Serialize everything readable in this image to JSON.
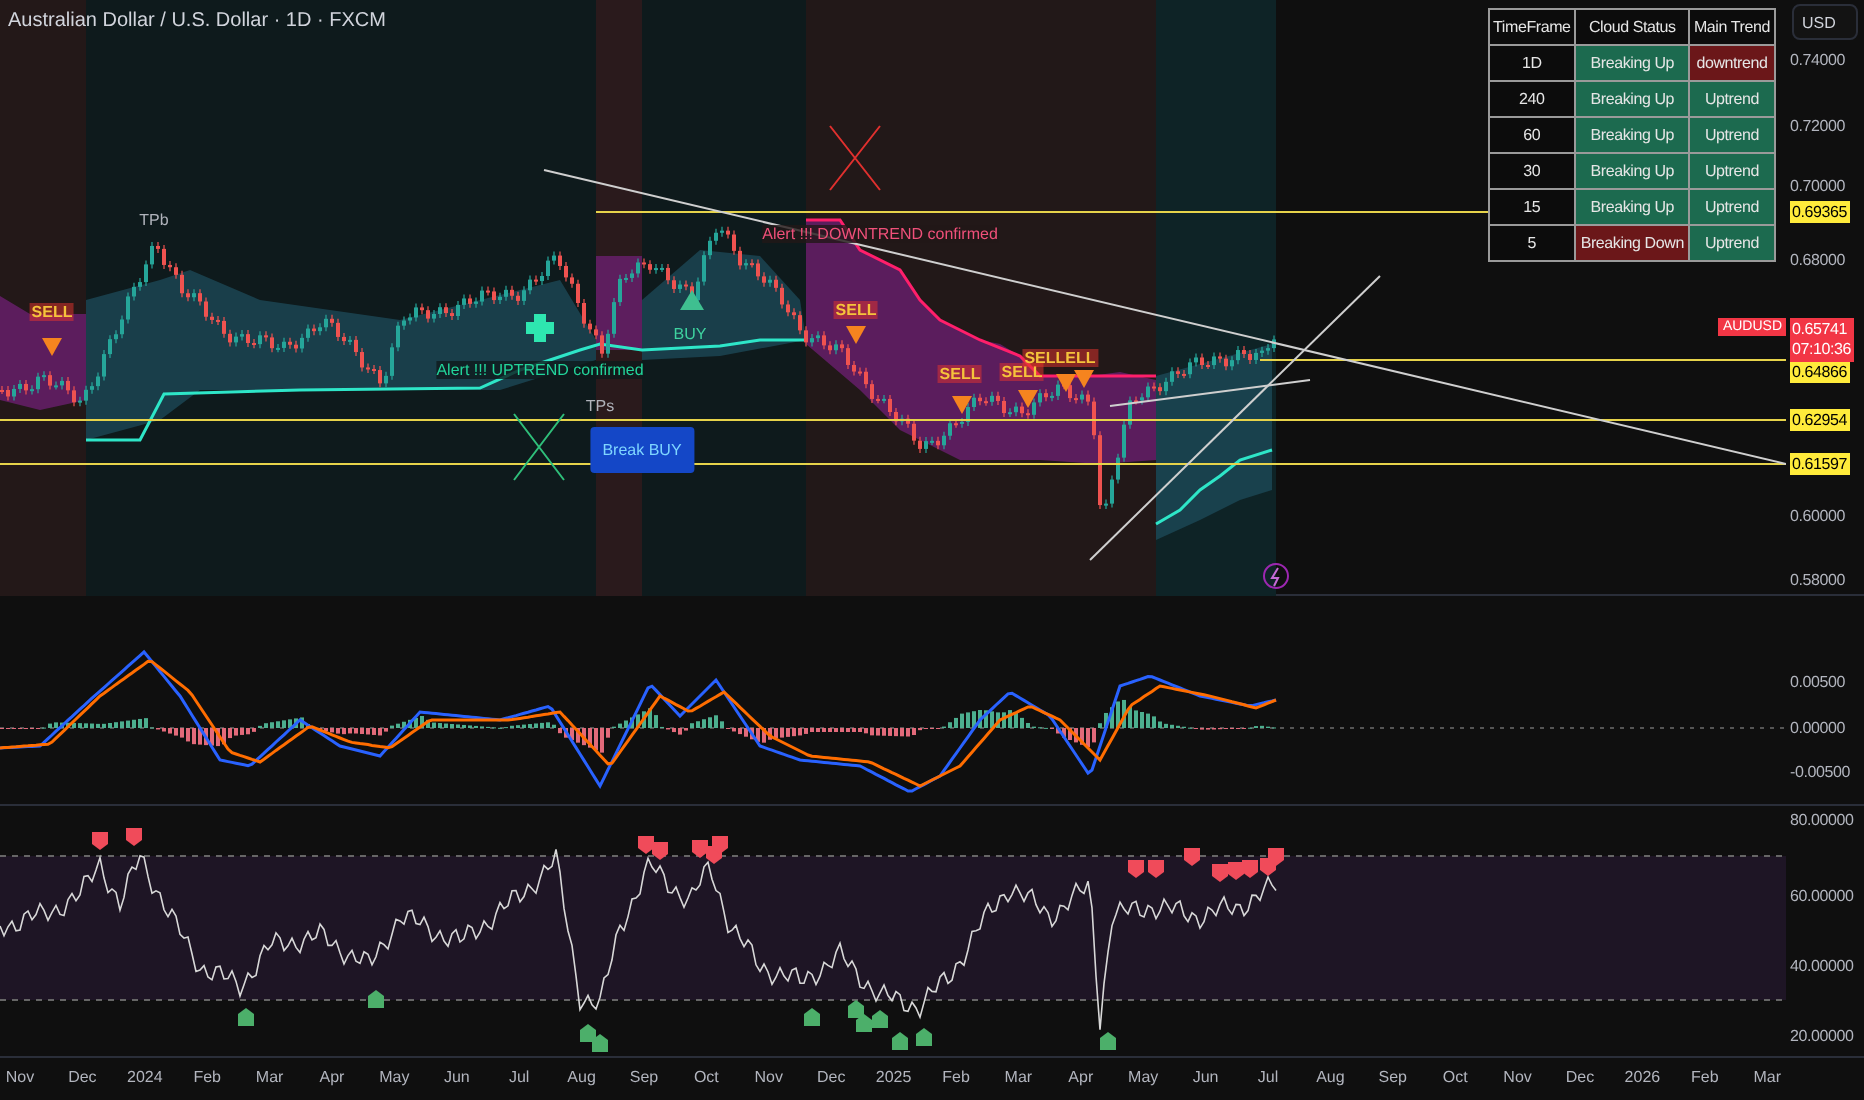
{
  "chart_header": {
    "title": "Australian Dollar / U.S. Dollar · 1D · FXCM"
  },
  "currency_button": {
    "label": "USD"
  },
  "price_axis": {
    "ticks": [
      "0.74000",
      "0.72000",
      "0.70000",
      "0.68000",
      "0.60000",
      "0.58000"
    ]
  },
  "price_levels": [
    "0.69365",
    "0.64866",
    "0.62954",
    "0.61597"
  ],
  "last_price": {
    "symbol": "AUDUSD",
    "price": "0.65741",
    "countdown": "07:10:36"
  },
  "chart_labels": [
    {
      "kind": "sell",
      "text": "SELL"
    },
    {
      "kind": "tp",
      "text": "TPb"
    },
    {
      "kind": "alert_up",
      "text": "Alert !!! UPTREND confirmed"
    },
    {
      "kind": "buy",
      "text": "BUY"
    },
    {
      "kind": "tp",
      "text": "TPs"
    },
    {
      "kind": "break",
      "text": "Break BUY"
    },
    {
      "kind": "alert_down",
      "text": "Alert !!! DOWNTREND confirmed"
    },
    {
      "kind": "sell",
      "text": "SELL"
    },
    {
      "kind": "sell",
      "text": "SELL"
    },
    {
      "kind": "sell",
      "text": "SELL"
    },
    {
      "kind": "sell",
      "text": "SELLELL"
    }
  ],
  "status_table": {
    "columns": [
      "TimeFrame",
      "Cloud Status",
      "Main Trend"
    ],
    "rows": [
      {
        "timeframe": "1D",
        "cloud_status": {
          "text": "Breaking Up",
          "color": "#1c6a4f"
        },
        "main_trend": {
          "text": "downtrend",
          "color": "#6b1719"
        }
      },
      {
        "timeframe": "240",
        "cloud_status": {
          "text": "Breaking Up",
          "color": "#1c6a4f"
        },
        "main_trend": {
          "text": "Uptrend",
          "color": "#1c6a4f"
        }
      },
      {
        "timeframe": "60",
        "cloud_status": {
          "text": "Breaking Up",
          "color": "#1c6a4f"
        },
        "main_trend": {
          "text": "Uptrend",
          "color": "#1c6a4f"
        }
      },
      {
        "timeframe": "30",
        "cloud_status": {
          "text": "Breaking Up",
          "color": "#1c6a4f"
        },
        "main_trend": {
          "text": "Uptrend",
          "color": "#1c6a4f"
        }
      },
      {
        "timeframe": "15",
        "cloud_status": {
          "text": "Breaking Up",
          "color": "#1c6a4f"
        },
        "main_trend": {
          "text": "Uptrend",
          "color": "#1c6a4f"
        }
      },
      {
        "timeframe": "5",
        "cloud_status": {
          "text": "Breaking Down",
          "color": "#6b1719"
        },
        "main_trend": {
          "text": "Uptrend",
          "color": "#1c6a4f"
        }
      }
    ]
  },
  "macd_axis": {
    "ticks": [
      "0.00500",
      "0.00000",
      "-0.00500"
    ]
  },
  "rsi_axis": {
    "ticks": [
      "80.00000",
      "60.00000",
      "40.00000",
      "20.00000"
    ]
  },
  "time_axis": {
    "labels": [
      "Nov",
      "Dec",
      "2024",
      "Feb",
      "Mar",
      "Apr",
      "May",
      "Jun",
      "Jul",
      "Aug",
      "Sep",
      "Oct",
      "Nov",
      "Dec",
      "2025",
      "Feb",
      "Mar",
      "Apr",
      "May",
      "Jun",
      "Jul",
      "Aug",
      "Sep",
      "Oct",
      "Nov",
      "Dec",
      "2026",
      "Feb",
      "Mar"
    ]
  }
}
